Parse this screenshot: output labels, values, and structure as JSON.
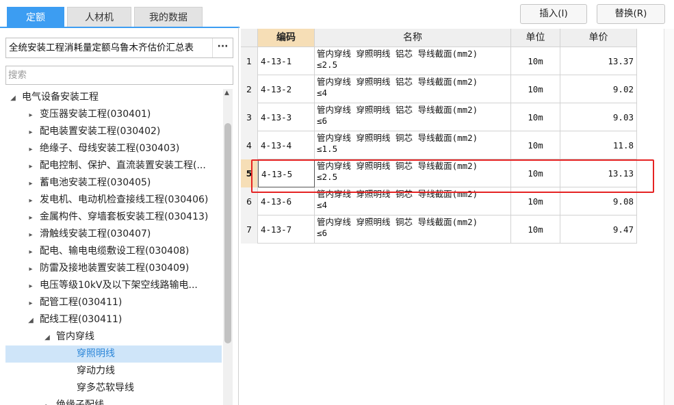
{
  "tabs": [
    {
      "label": "定额",
      "active": true
    },
    {
      "label": "人材机",
      "active": false
    },
    {
      "label": "我的数据",
      "active": false
    }
  ],
  "library": {
    "name": "全统安装工程消耗量定额乌鲁木齐估价汇总表",
    "more_label": "···"
  },
  "search": {
    "placeholder": "搜索",
    "value": ""
  },
  "tree": [
    {
      "label": "电气设备安装工程",
      "arrow": "◢",
      "level": 0
    },
    {
      "label": "变压器安装工程(030401)",
      "arrow": "▸",
      "level": 1
    },
    {
      "label": "配电装置安装工程(030402)",
      "arrow": "▸",
      "level": 1
    },
    {
      "label": "绝缘子、母线安装工程(030403)",
      "arrow": "▸",
      "level": 1
    },
    {
      "label": "配电控制、保护、直流装置安装工程(...",
      "arrow": "▸",
      "level": 1
    },
    {
      "label": "蓄电池安装工程(030405)",
      "arrow": "▸",
      "level": 1
    },
    {
      "label": "发电机、电动机检查接线工程(030406)",
      "arrow": "▸",
      "level": 1
    },
    {
      "label": "金属构件、穿墙套板安装工程(030413)",
      "arrow": "▸",
      "level": 1
    },
    {
      "label": "滑触线安装工程(030407)",
      "arrow": "▸",
      "level": 1
    },
    {
      "label": "配电、输电电缆敷设工程(030408)",
      "arrow": "▸",
      "level": 1
    },
    {
      "label": "防雷及接地装置安装工程(030409)",
      "arrow": "▸",
      "level": 1
    },
    {
      "label": "电压等级10kV及以下架空线路输电...",
      "arrow": "▸",
      "level": 1
    },
    {
      "label": "配管工程(030411)",
      "arrow": "▸",
      "level": 1
    },
    {
      "label": "配线工程(030411)",
      "arrow": "◢",
      "level": 1
    },
    {
      "label": "管内穿线",
      "arrow": "◢",
      "level": 2
    },
    {
      "label": "穿照明线",
      "arrow": "",
      "level": 3,
      "selected": true
    },
    {
      "label": "穿动力线",
      "arrow": "",
      "level": 3
    },
    {
      "label": "穿多芯软导线",
      "arrow": "",
      "level": 3
    },
    {
      "label": "绝缘子配线",
      "arrow": "▸",
      "level": 2
    }
  ],
  "toolbar": {
    "insert_label": "插入(I)",
    "replace_label": "替换(R)"
  },
  "grid": {
    "headers": {
      "code": "编码",
      "name": "名称",
      "unit": "单位",
      "price": "单价"
    },
    "current_row": 5,
    "rows": [
      {
        "idx": "1",
        "code": "4-13-1",
        "name": "管内穿线 穿照明线 铝芯 导线截面(mm2)\n≤2.5",
        "unit": "10m",
        "price": "13.37"
      },
      {
        "idx": "2",
        "code": "4-13-2",
        "name": "管内穿线 穿照明线 铝芯 导线截面(mm2)\n≤4",
        "unit": "10m",
        "price": "9.02"
      },
      {
        "idx": "3",
        "code": "4-13-3",
        "name": "管内穿线 穿照明线 铝芯 导线截面(mm2)\n≤6",
        "unit": "10m",
        "price": "9.03"
      },
      {
        "idx": "4",
        "code": "4-13-4",
        "name": "管内穿线 穿照明线 铜芯 导线截面(mm2)\n≤1.5",
        "unit": "10m",
        "price": "11.8"
      },
      {
        "idx": "5",
        "code": "4-13-5",
        "name": "管内穿线 穿照明线 铜芯 导线截面(mm2)\n≤2.5",
        "unit": "10m",
        "price": "13.13"
      },
      {
        "idx": "6",
        "code": "4-13-6",
        "name": "管内穿线 穿照明线 铜芯 导线截面(mm2)\n≤4",
        "unit": "10m",
        "price": "9.08"
      },
      {
        "idx": "7",
        "code": "4-13-7",
        "name": "管内穿线 穿照明线 铜芯 导线截面(mm2)\n≤6",
        "unit": "10m",
        "price": "9.47"
      }
    ]
  },
  "colors": {
    "accent": "#3c9df2",
    "highlight_border": "#e52222",
    "selected_bg": "#cfe5f9",
    "code_header_bg": "#f6deb6"
  }
}
